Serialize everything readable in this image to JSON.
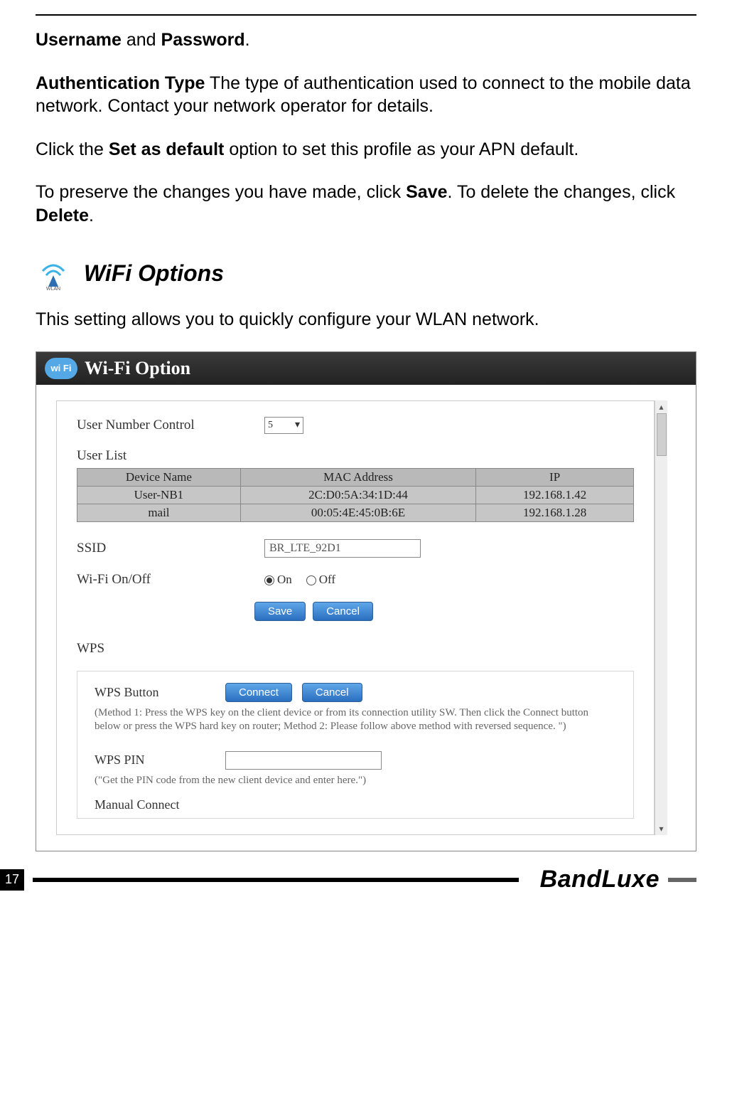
{
  "intro": {
    "line1a": "Username",
    "line1b": " and ",
    "line1c": "Password",
    "line1d": ".",
    "p2a": "Authentication Type",
    "p2b": " The type of authentication used to connect to the mobile data network. Contact your network operator for details.",
    "p3a": "Click the ",
    "p3b": "Set as default",
    "p3c": " option to set this profile as your APN default.",
    "p4a": "To preserve the changes you have made, click ",
    "p4b": "Save",
    "p4c": ". To delete the changes, click ",
    "p4d": "Delete",
    "p4e": "."
  },
  "section_heading": "WiFi Options",
  "section_body": "This setting allows you to quickly configure your WLAN network.",
  "shot": {
    "title": "Wi-Fi Option",
    "badge": "wi Fi",
    "user_number_control_label": "User Number Control",
    "user_number_control_value": "5",
    "user_list_label": "User List",
    "table": {
      "headers": [
        "Device Name",
        "MAC Address",
        "IP"
      ],
      "rows": [
        [
          "User-NB1",
          "2C:D0:5A:34:1D:44",
          "192.168.1.42"
        ],
        [
          "mail",
          "00:05:4E:45:0B:6E",
          "192.168.1.28"
        ]
      ]
    },
    "ssid_label": "SSID",
    "ssid_value": "BR_LTE_92D1",
    "wifi_onoff_label": "Wi-Fi On/Off",
    "radio_on": "On",
    "radio_off": "Off",
    "save_btn": "Save",
    "cancel_btn": "Cancel",
    "wps_heading": "WPS",
    "wps_button_label": "WPS Button",
    "wps_connect": "Connect",
    "wps_cancel": "Cancel",
    "wps_hint": "(Method 1: Press the WPS key on the client device or from its connection utility SW. Then click the Connect button below or press the WPS hard key on router; Method 2: Please follow above method with reversed sequence. \")",
    "wps_pin_label": "WPS PIN",
    "wps_pin_hint": "(\"Get the PIN code from the new client device and enter here.\")",
    "manual_connect_label": "Manual Connect"
  },
  "footer": {
    "page_number": "17",
    "brand": "BandLuxe"
  }
}
